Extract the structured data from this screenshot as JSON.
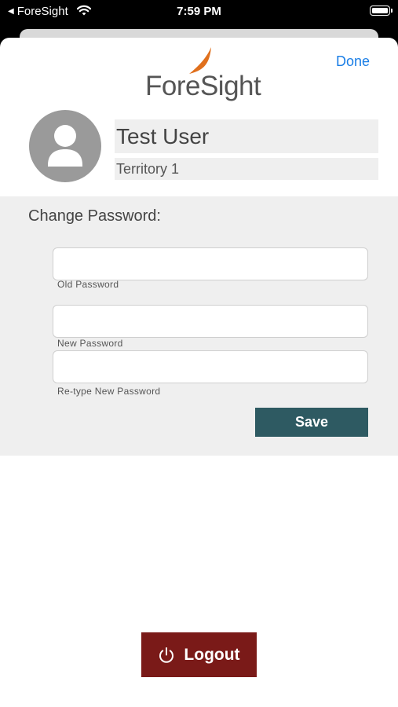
{
  "status_bar": {
    "back_app": "ForeSight",
    "time": "7:59 PM"
  },
  "header": {
    "done_label": "Done",
    "logo_text": "ForeSight"
  },
  "profile": {
    "name": "Test User",
    "territory": "Territory 1"
  },
  "change_password": {
    "heading": "Change Password:",
    "old_label": "Old Password",
    "new_label": "New Password",
    "retype_label": "Re-type New Password",
    "save_label": "Save"
  },
  "logout_label": "Logout",
  "colors": {
    "accent": "#1a7ee6",
    "save": "#2e5a62",
    "logout": "#7a1a18",
    "logo_swoosh": "#e0701d"
  }
}
